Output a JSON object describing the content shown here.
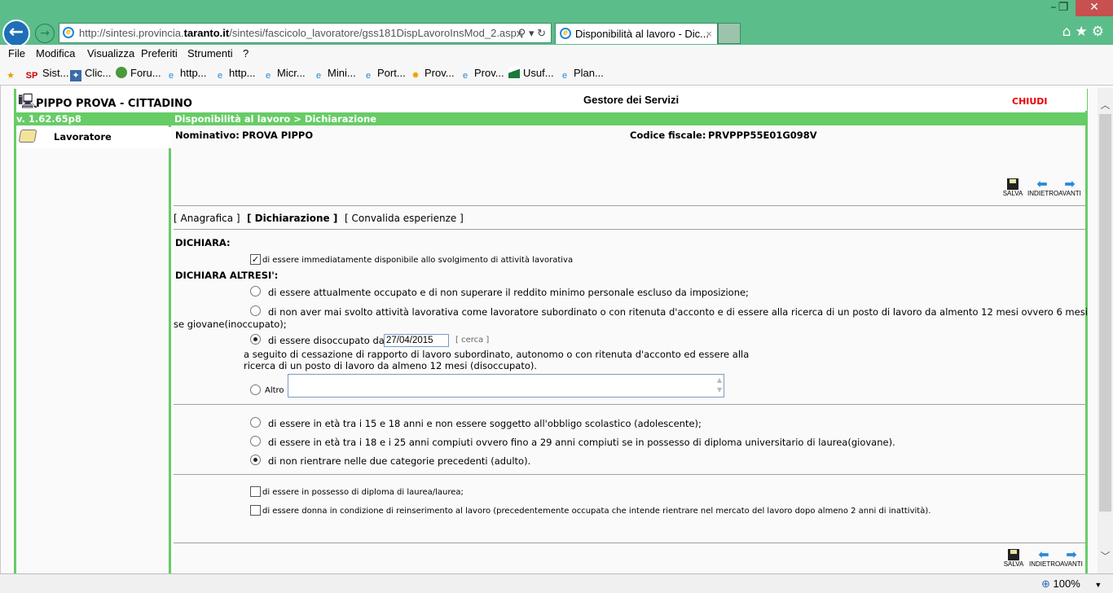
{
  "browser": {
    "address_domain_prefix": "http://sintesi.provincia.",
    "address_domain": "taranto.it",
    "address_path": "/sintesi/fascicolo_lavoratore/gss181DispLavoroInsMod_2.aspx",
    "tab_title": "Disponibilità al lavoro - Dic...",
    "window_controls": {
      "minimize": "–",
      "restore": "❐",
      "close": "✕"
    },
    "menu": [
      "File",
      "Modifica",
      "Visualizza",
      "Preferiti",
      "Strumenti",
      "?"
    ],
    "favorites": [
      {
        "icon": "sp-icon",
        "label": "Sist..."
      },
      {
        "icon": "click-icon",
        "label": "Clic..."
      },
      {
        "icon": "globe-icon",
        "label": "Foru..."
      },
      {
        "icon": "ie-page-icon",
        "label": "http..."
      },
      {
        "icon": "ie-page-icon",
        "label": "http..."
      },
      {
        "icon": "ie-page-icon",
        "label": "Micr..."
      },
      {
        "icon": "ie-page-icon",
        "label": "Mini..."
      },
      {
        "icon": "ie-page-icon",
        "label": "Port..."
      },
      {
        "icon": "sun-icon",
        "label": "Prov..."
      },
      {
        "icon": "ie-page-icon",
        "label": "Prov..."
      },
      {
        "icon": "flag-icon",
        "label": "Usuf..."
      },
      {
        "icon": "ie-page-icon",
        "label": "Plan..."
      }
    ],
    "zoom_level": "100%"
  },
  "app": {
    "user_title": "PIPPO PROVA - CITTADINO",
    "center_title": "Gestore dei Servizi",
    "close_label": "CHIUDI",
    "version": "v. 1.62.65p8",
    "breadcrumb": "Disponibilità al lavoro > Dichiarazione",
    "sidebar_item": "Lavoratore"
  },
  "person": {
    "nominativo_label": "Nominativo:",
    "nominativo_value": "PROVA  PIPPO",
    "cf_label": "Codice fiscale:",
    "cf_value": "PRVPPP55E01G098V"
  },
  "toolbar": {
    "save": "SALVA",
    "back": "INDIETRO",
    "forward": "AVANTI"
  },
  "tabs": [
    {
      "label": "[ Anagrafica ]",
      "active": false
    },
    {
      "label": "[ Dichiarazione ]",
      "active": true
    },
    {
      "label": "[ Convalida esperienze ]",
      "active": false
    }
  ],
  "form": {
    "dichiara_heading": "DICHIARA:",
    "dichiara_check": {
      "label": "di essere immediatamente disponibile allo svolgimento di attività lavorativa",
      "checked": true
    },
    "altresi_heading": "DICHIARA ALTRESI':",
    "status_options": [
      {
        "label": "di essere attualmente occupato e di non superare il reddito minimo personale escluso da imposizione;",
        "selected": false
      },
      {
        "label": "di non aver mai svolto attività lavorativa come lavoratore subordinato o con ritenuta d'acconto e di essere alla ricerca di un posto di lavoro da almento 12 mesi ovvero 6 mesi",
        "label_line2": "se giovane(inoccupato);",
        "selected": false
      },
      {
        "label": "di essere disoccupato dal",
        "date_value": "27/04/2015",
        "search_label": "[ cerca ]",
        "label_line2": "a seguito di cessazione di rapporto di lavoro subordinato, autonomo o con ritenuta d'acconto ed essere alla",
        "label_line3": "ricerca di un posto di lavoro da almeno 12 mesi (disoccupato).",
        "selected": true
      },
      {
        "label": "Altro",
        "text_value": "",
        "selected": false
      }
    ],
    "age_options": [
      {
        "label": "di essere in età tra i 15 e 18 anni e non essere soggetto all'obbligo scolastico (adolescente);",
        "selected": false
      },
      {
        "label": "di essere in età tra i 18 e i 25 anni compiuti ovvero fino a 29 anni compiuti se in possesso di diploma universitario di laurea(giovane).",
        "selected": false
      },
      {
        "label": "di non rientrare nelle due categorie precedenti (adulto).",
        "selected": true
      }
    ],
    "extra_checks": [
      {
        "label": "di essere in possesso di diploma di laurea/laurea;",
        "checked": false
      },
      {
        "label": "di essere donna in condizione di reinserimento al lavoro (precedentemente occupata che intende rientrare nel mercato del lavoro dopo almeno 2 anni di inattività).",
        "checked": false
      }
    ]
  }
}
